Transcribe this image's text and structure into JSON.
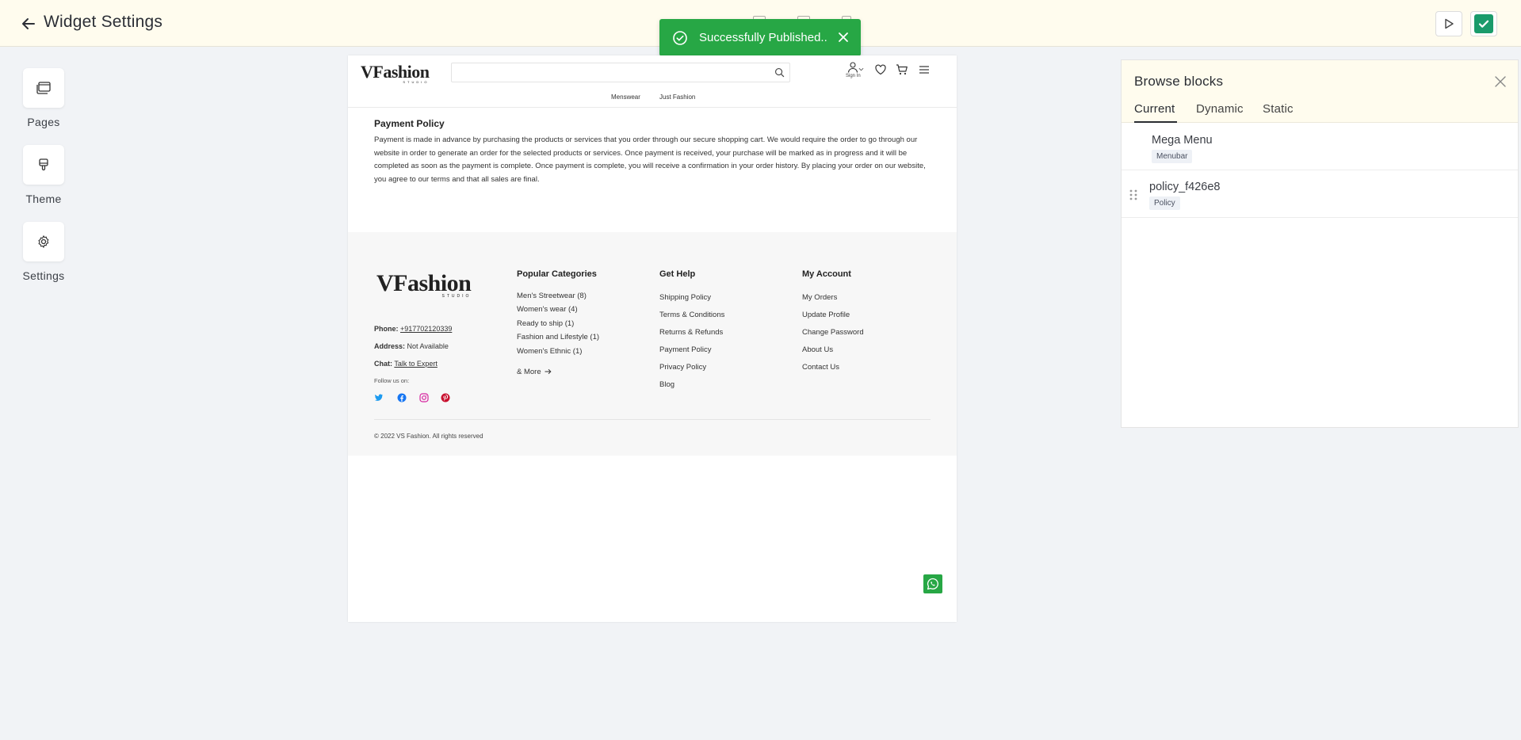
{
  "topbar": {
    "title": "Widget Settings"
  },
  "toast": {
    "message": "Successfully Published.."
  },
  "sidenav": {
    "items": [
      {
        "label": "Pages"
      },
      {
        "label": "Theme"
      },
      {
        "label": "Settings"
      }
    ]
  },
  "preview": {
    "logo_main": "VFashion",
    "logo_sub": "STUDIO",
    "search_placeholder": "",
    "signin_label": "Sign In",
    "nav": [
      "Menswear",
      "Just Fashion"
    ],
    "policy": {
      "title": "Payment Policy",
      "text": "Payment is made in advance by purchasing the products or services that you order through our secure shopping cart. We would require the order to go through our website in order to generate an order for the selected products or services. Once payment is received, your purchase will be marked as in progress and it will be completed as soon as the payment is complete. Once payment is complete, you will receive a confirmation in your order history. By placing your order on our website, you agree to our terms and that all sales are final."
    },
    "footer": {
      "phone_label": "Phone:",
      "phone_value": "+917702120339",
      "address_label": "Address:",
      "address_value": "Not Available",
      "chat_label": "Chat:",
      "chat_value": "Talk to Expert",
      "follow_label": "Follow us on:",
      "columns": [
        {
          "title": "Popular Categories",
          "items": [
            "Men's Streetwear (8)",
            "Women's wear (4)",
            "Ready to ship (1)",
            "Fashion and Lifestyle (1)",
            "Women's Ethnic (1)"
          ],
          "more": "& More"
        },
        {
          "title": "Get Help",
          "items": [
            "Shipping Policy",
            "Terms & Conditions",
            "Returns & Refunds",
            "Payment Policy",
            "Privacy Policy",
            "Blog"
          ]
        },
        {
          "title": "My Account",
          "items": [
            "My Orders",
            "Update Profile",
            "Change Password",
            "About Us",
            "Contact Us"
          ]
        }
      ],
      "copyright": "© 2022 VS Fashion. All rights reserved"
    }
  },
  "panel": {
    "title": "Browse blocks",
    "tabs": [
      "Current",
      "Dynamic",
      "Static"
    ],
    "blocks": [
      {
        "name": "Mega Menu",
        "tag": "Menubar"
      },
      {
        "name": "policy_f426e8",
        "tag": "Policy"
      }
    ]
  },
  "colors": {
    "accent_green": "#27a745",
    "save_green": "#1a9b6b",
    "topbar_bg": "#fffcee"
  }
}
